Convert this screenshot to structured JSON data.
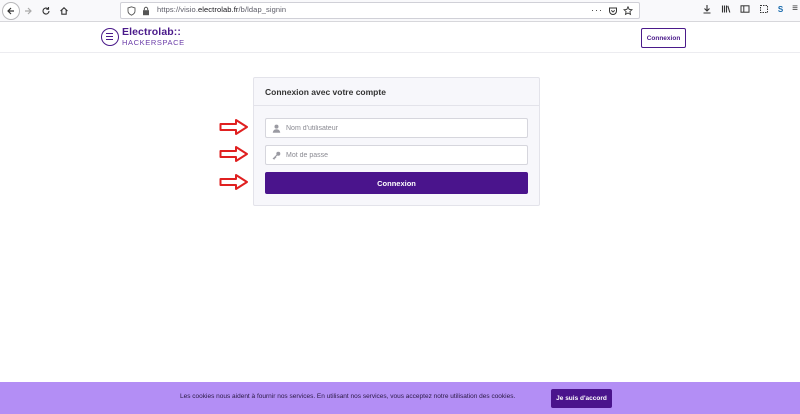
{
  "browser": {
    "url_prefix": "https://visio.",
    "url_domain": "electrolab.fr",
    "url_path": "/b/ldap_signin",
    "profile_initial": "S"
  },
  "header": {
    "logo_title": "Electrolab::",
    "logo_subtitle": "HACKERSPACE",
    "login_button": "Connexion"
  },
  "login": {
    "title": "Connexion avec votre compte",
    "username_placeholder": "Nom d'utilisateur",
    "password_placeholder": "Mot de passe",
    "submit_label": "Connexion"
  },
  "cookie_banner": {
    "text": "Les cookies nous aident à fournir nos services. En utilisant nos services, vous acceptez notre utilisation des cookies.",
    "accept_label": "Je suis d'accord"
  },
  "icons": {
    "back": "back-arrow-icon",
    "forward": "forward-arrow-icon",
    "reload": "reload-icon",
    "home": "home-icon",
    "shield": "shield-icon",
    "lock": "lock-icon",
    "user": "user-icon",
    "key": "key-icon",
    "annotation_arrow": "red-arrow-icon"
  },
  "colors": {
    "brand": "#4a148c",
    "banner": "#b38ef5",
    "arrow": "#e02020"
  }
}
